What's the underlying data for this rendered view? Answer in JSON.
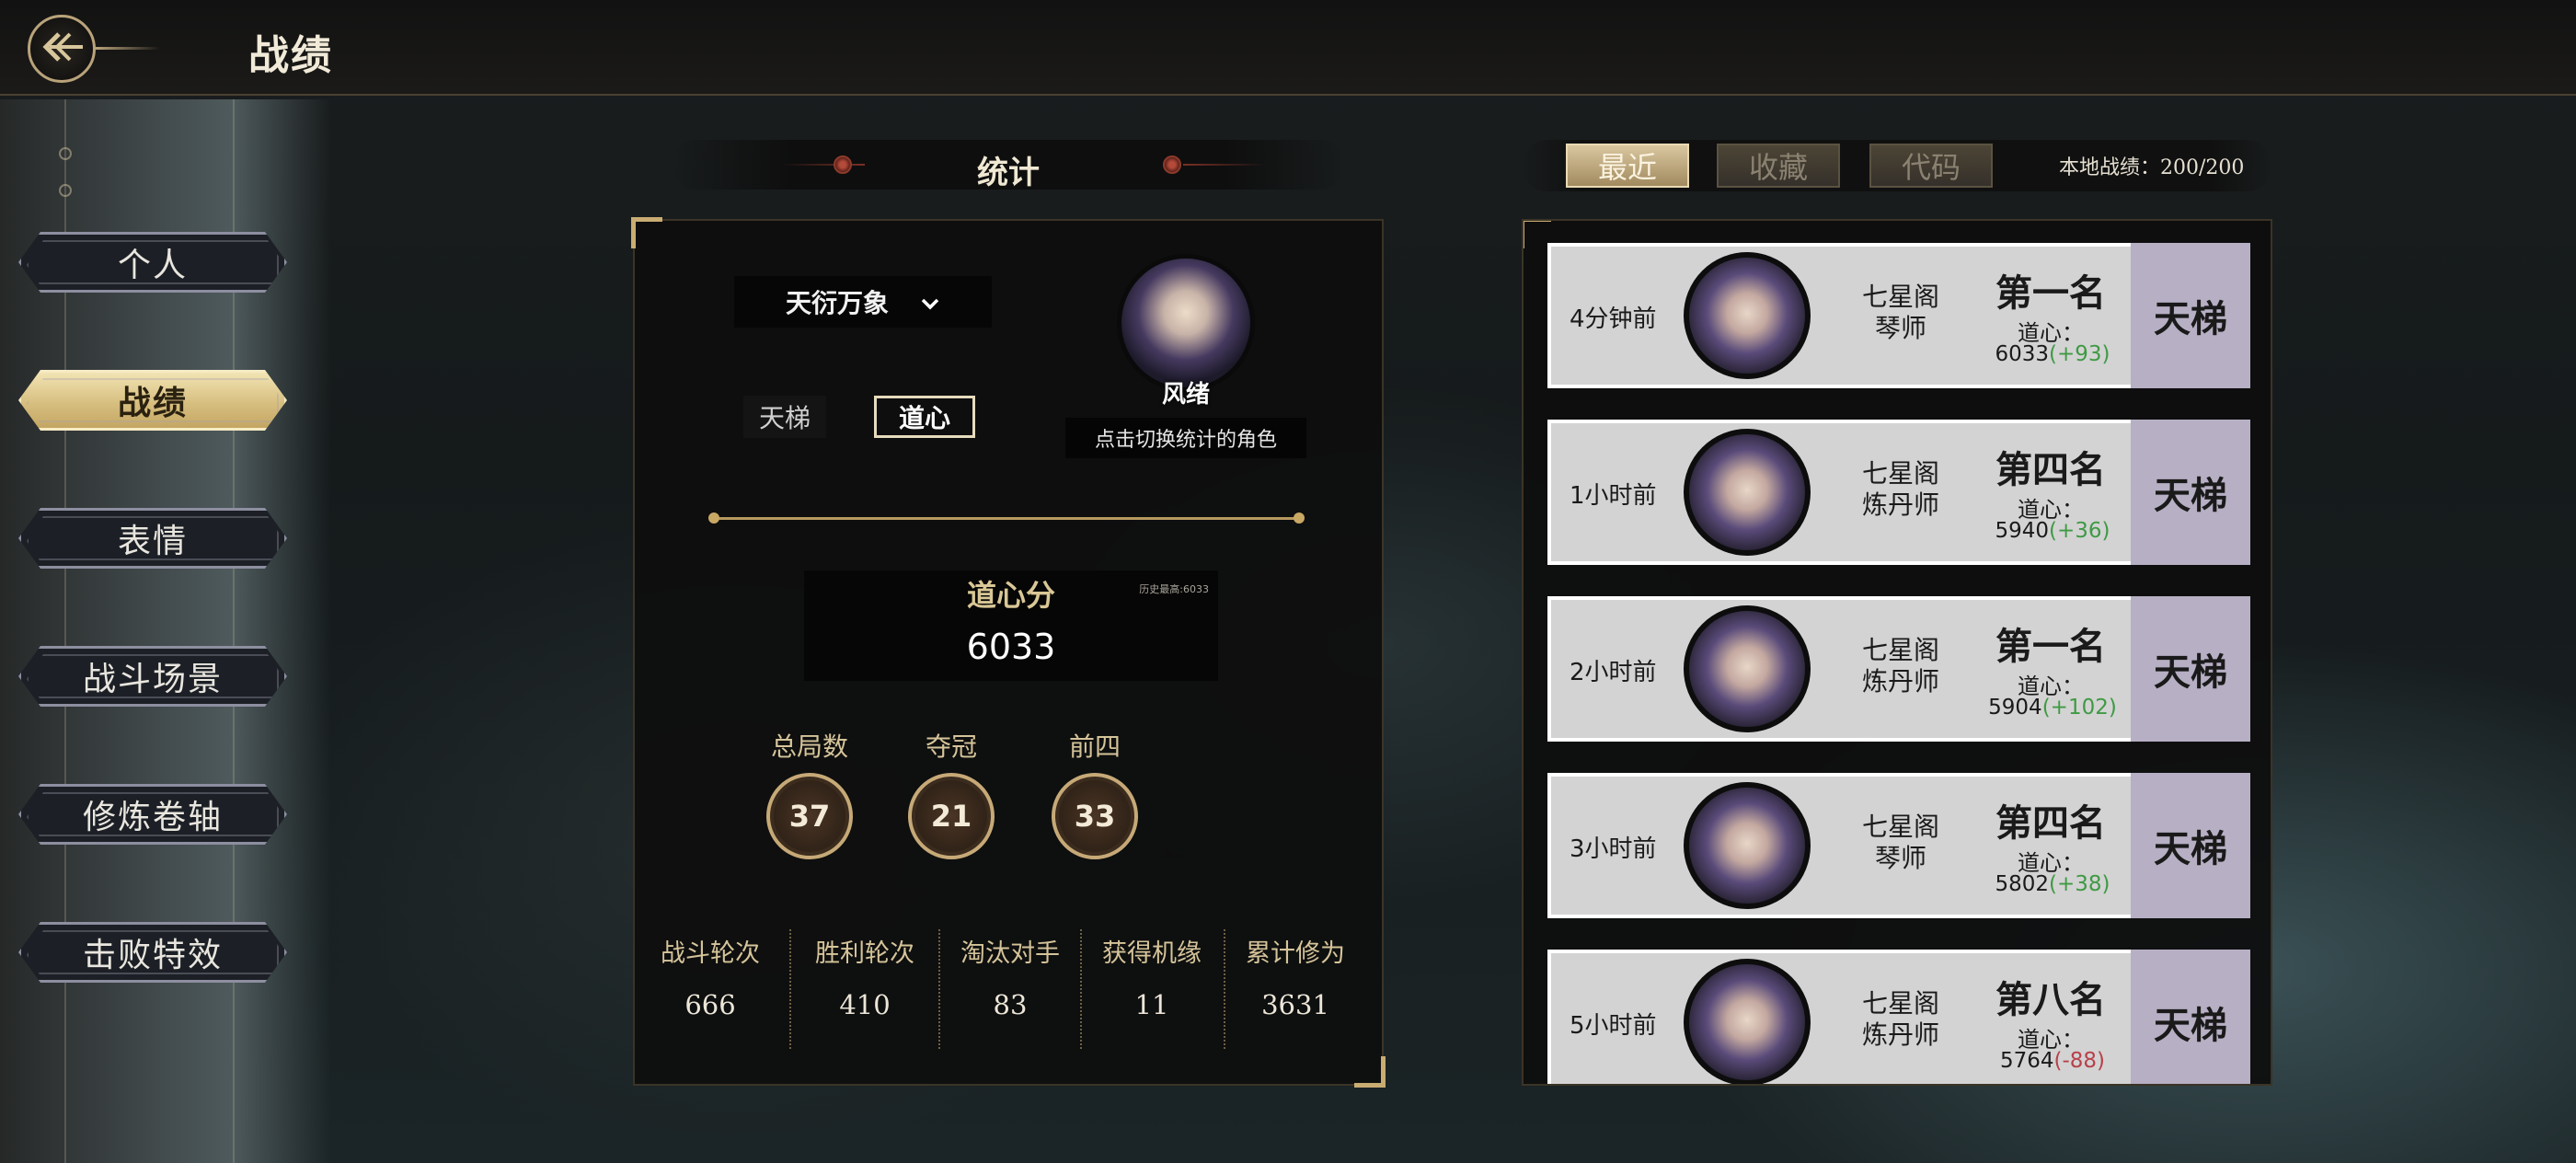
{
  "header": {
    "title": "战绩"
  },
  "sidebar": {
    "items": [
      {
        "label": "个人",
        "active": false
      },
      {
        "label": "战绩",
        "active": true
      },
      {
        "label": "表情",
        "active": false
      },
      {
        "label": "战斗场景",
        "active": false
      },
      {
        "label": "修炼卷轴",
        "active": false
      },
      {
        "label": "击败特效",
        "active": false
      }
    ]
  },
  "stats": {
    "header": "统计",
    "character_select": "天衍万象",
    "mode_tabs": [
      {
        "label": "天梯",
        "active": false
      },
      {
        "label": "道心",
        "active": true
      }
    ],
    "avatar": {
      "name": "风绪",
      "hint": "点击切换统计的角色"
    },
    "score": {
      "label": "道心分",
      "best": "历史最高:6033",
      "value": "6033"
    },
    "circles": [
      {
        "label": "总局数",
        "value": "37"
      },
      {
        "label": "夺冠",
        "value": "21"
      },
      {
        "label": "前四",
        "value": "33"
      }
    ],
    "bottom": [
      {
        "label": "战斗轮次",
        "value": "666"
      },
      {
        "label": "胜利轮次",
        "value": "410"
      },
      {
        "label": "淘汰对手",
        "value": "83"
      },
      {
        "label": "获得机缘",
        "value": "11"
      },
      {
        "label": "累计修为",
        "value": "3631"
      }
    ]
  },
  "history": {
    "tabs": [
      {
        "label": "最近",
        "active": true
      },
      {
        "label": "收藏",
        "active": false
      },
      {
        "label": "代码",
        "active": false
      }
    ],
    "local_count": "本地战绩：200/200",
    "dx_label": "道心：",
    "matches": [
      {
        "time": "4分钟前",
        "sect": "七星阁",
        "role": "琴师",
        "rank": "第一名",
        "score": "6033",
        "delta": "(+93)",
        "delta_sign": "pos",
        "mode": "天梯"
      },
      {
        "time": "1小时前",
        "sect": "七星阁",
        "role": "炼丹师",
        "rank": "第四名",
        "score": "5940",
        "delta": "(+36)",
        "delta_sign": "pos",
        "mode": "天梯"
      },
      {
        "time": "2小时前",
        "sect": "七星阁",
        "role": "炼丹师",
        "rank": "第一名",
        "score": "5904",
        "delta": "(+102)",
        "delta_sign": "pos",
        "mode": "天梯"
      },
      {
        "time": "3小时前",
        "sect": "七星阁",
        "role": "琴师",
        "rank": "第四名",
        "score": "5802",
        "delta": "(+38)",
        "delta_sign": "pos",
        "mode": "天梯"
      },
      {
        "time": "5小时前",
        "sect": "七星阁",
        "role": "炼丹师",
        "rank": "第八名",
        "score": "5764",
        "delta": "(-88)",
        "delta_sign": "neg",
        "mode": "天梯"
      }
    ]
  },
  "colors": {
    "gold": "#c9ac72",
    "positive": "#3f9a44",
    "negative": "#b8404a",
    "mode_bg": "#b7afc4"
  },
  "icons": {
    "back": "back-arrow-icon",
    "dropdown": "chevron-down-icon"
  }
}
